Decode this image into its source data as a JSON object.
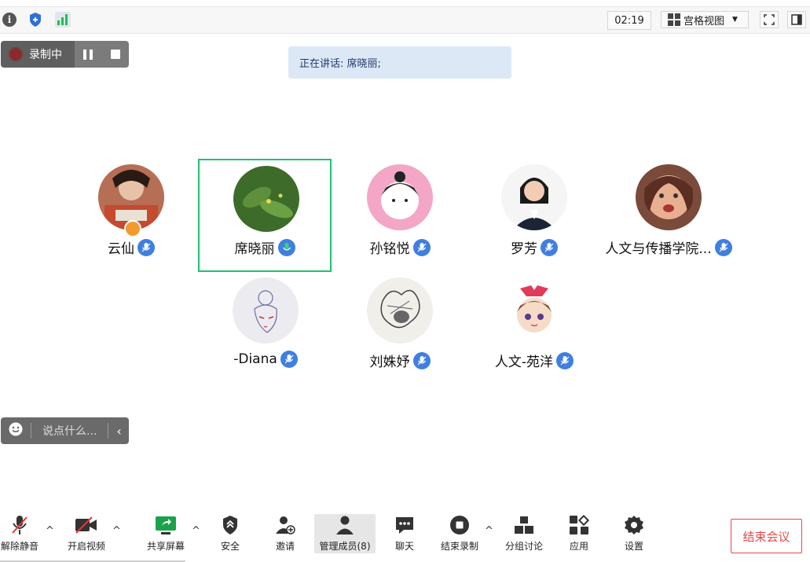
{
  "topbar": {
    "timer": "02:19",
    "view_label": "宫格视图",
    "icons": [
      "info-icon",
      "shield-icon",
      "signal-icon",
      "fullscreen-icon",
      "side-panel-icon"
    ]
  },
  "recording": {
    "label": "录制中"
  },
  "speaking": {
    "text": "正在讲话: 席晓丽;"
  },
  "participants": [
    {
      "name": "云仙",
      "host": true
    },
    {
      "name": "席晓丽",
      "speaking": true
    },
    {
      "name": "孙铭悦"
    },
    {
      "name": "罗芳"
    },
    {
      "name": "人文与传播学院..."
    },
    {
      "name": "-Diana"
    },
    {
      "name": "刘姝妤"
    },
    {
      "name": "人文-苑洋"
    }
  ],
  "chat": {
    "placeholder": "说点什么..."
  },
  "toolbar": {
    "unmute": "解除静音",
    "video": "开启视频",
    "share": "共享屏幕",
    "security": "安全",
    "invite": "邀请",
    "members": "管理成员(8)",
    "chat": "聊天",
    "stop_record": "结束录制",
    "breakout": "分组讨论",
    "apps": "应用",
    "settings": "设置",
    "end_meeting": "结束会议"
  },
  "colors": {
    "accent_blue": "#3f7fe0",
    "speaking_green": "#1fc36e",
    "end_red": "#e64b4b"
  }
}
